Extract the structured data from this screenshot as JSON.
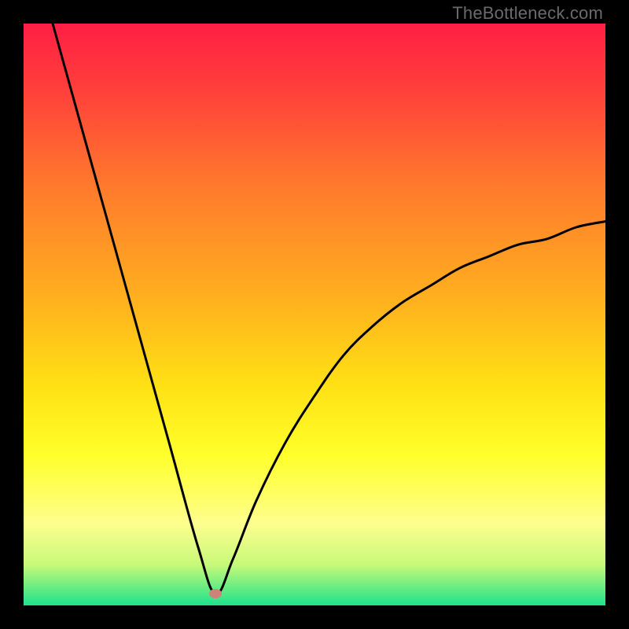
{
  "watermark": {
    "text": "TheBottleneck.com"
  },
  "colors": {
    "frame_bg": "#000000",
    "curve": "#000000",
    "marker": "#cf8279",
    "gradient_stops": [
      {
        "offset": 0,
        "color": "#ff1f44"
      },
      {
        "offset": 0.1,
        "color": "#ff3b3c"
      },
      {
        "offset": 0.28,
        "color": "#ff7a2c"
      },
      {
        "offset": 0.48,
        "color": "#ffb21e"
      },
      {
        "offset": 0.62,
        "color": "#ffe014"
      },
      {
        "offset": 0.74,
        "color": "#ffff2a"
      },
      {
        "offset": 0.86,
        "color": "#fdfe8e"
      },
      {
        "offset": 0.93,
        "color": "#c7f979"
      },
      {
        "offset": 0.97,
        "color": "#66ec83"
      },
      {
        "offset": 1.0,
        "color": "#1ee28c"
      }
    ]
  },
  "chart_data": {
    "type": "line",
    "title": "",
    "xlabel": "",
    "ylabel": "",
    "xlim": [
      0,
      100
    ],
    "ylim": [
      0,
      100
    ],
    "x_optimum": 33,
    "y_at_right_edge": 66,
    "series": [
      {
        "name": "bottleneck-curve",
        "x": [
          5,
          10,
          15,
          20,
          25,
          30,
          33,
          36,
          40,
          45,
          50,
          55,
          60,
          65,
          70,
          75,
          80,
          85,
          90,
          95,
          100
        ],
        "y": [
          100,
          82,
          64,
          46,
          28,
          10,
          2,
          8,
          18,
          28,
          36,
          43,
          48,
          52,
          55,
          58,
          60,
          62,
          63,
          65,
          66
        ]
      }
    ],
    "annotations": [
      {
        "name": "optimum-marker",
        "x": 33,
        "y": 2
      }
    ]
  }
}
